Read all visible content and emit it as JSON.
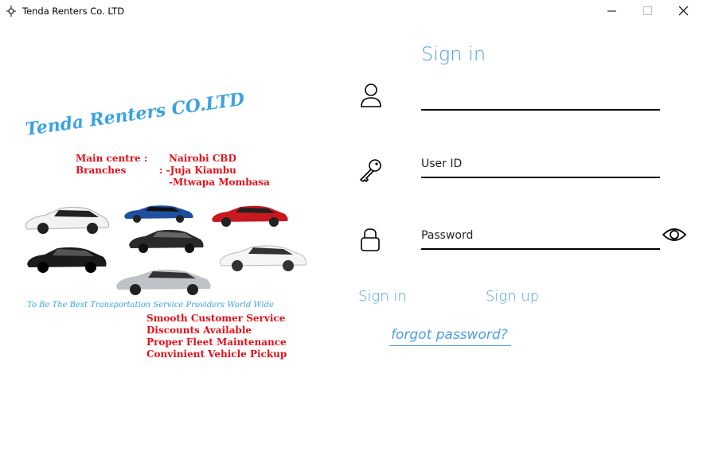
{
  "window": {
    "title": "Tenda Renters Co. LTD",
    "controls": [
      "minimize",
      "maximize",
      "close"
    ]
  },
  "banner": {
    "company": "Tenda Renters CO.LTD",
    "main_centre_label": "Main centre :",
    "main_centre_value": "Nairobi CBD",
    "branches_label": "Branches",
    "branch_1": ": -Juja Kiambu",
    "branch_2": "-Mtwapa Mombasa",
    "slogan": "To Be The Best Transportation Service Providers World Wide",
    "features": [
      "Smooth Customer Service",
      "Discounts Available",
      "Proper Fleet Maintenance",
      "Convinient Vehicle Pickup"
    ]
  },
  "form": {
    "title": "Sign in",
    "username": {
      "value": "",
      "icon": "user-icon"
    },
    "user_id": {
      "placeholder": "User ID",
      "icon": "key-icon"
    },
    "password": {
      "placeholder": "Password",
      "icon": "lock-icon",
      "toggle_icon": "eye-icon"
    },
    "signin_label": "Sign in",
    "signup_label": "Sign up",
    "forgot_label": "forgot password?"
  },
  "colors": {
    "accent": "#4a9ee6",
    "banner_red": "#e3101a",
    "banner_blue": "#3aa3e3"
  }
}
